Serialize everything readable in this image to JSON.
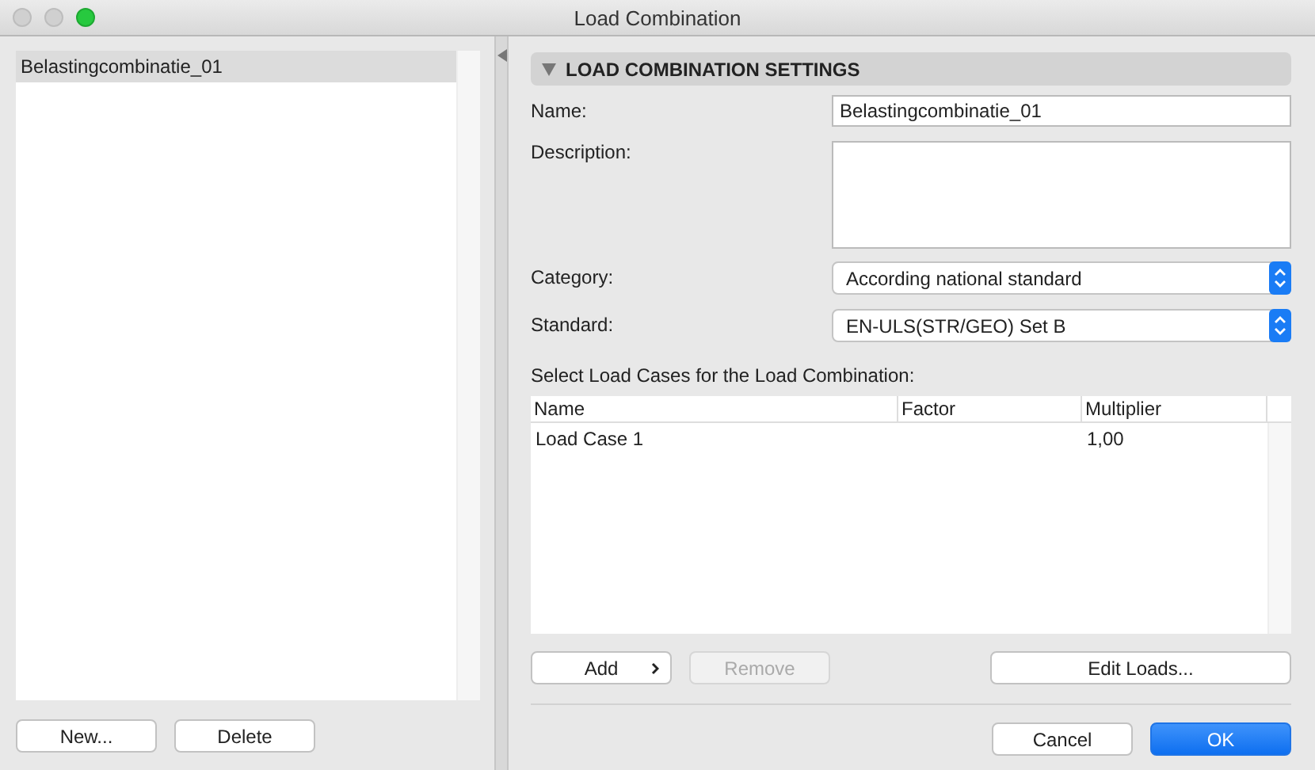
{
  "window": {
    "title": "Load Combination"
  },
  "list": {
    "items": [
      {
        "label": "Belastingcombinatie_01",
        "selected": true
      }
    ]
  },
  "list_buttons": [
    {
      "label": "New..."
    },
    {
      "label": "Delete"
    }
  ],
  "section": {
    "title": "LOAD COMBINATION SETTINGS",
    "expanded": true
  },
  "form": {
    "name": {
      "label": "Name:",
      "value": "Belastingcombinatie_01"
    },
    "description": {
      "label": "Description:"
    },
    "category": {
      "label": "Category:",
      "value": "According national standard"
    },
    "standard": {
      "label": "Standard:",
      "value": "EN-ULS(STR/GEO) Set B"
    }
  },
  "table": {
    "caption": "Select Load Cases for the Load Combination:",
    "columns": [
      "Name",
      "Factor",
      "Multiplier"
    ],
    "rows": [
      [
        "Load Case 1",
        "",
        "1,00"
      ]
    ]
  },
  "table_buttons": [
    {
      "label": "Add",
      "kind": "menu",
      "disabled": false
    },
    {
      "label": "Remove",
      "kind": "plain",
      "disabled": true
    },
    {
      "label": "Edit Loads...",
      "kind": "plain",
      "disabled": false
    }
  ],
  "dialog_buttons": [
    {
      "label": "Cancel",
      "primary": false
    },
    {
      "label": "OK",
      "primary": true
    }
  ]
}
